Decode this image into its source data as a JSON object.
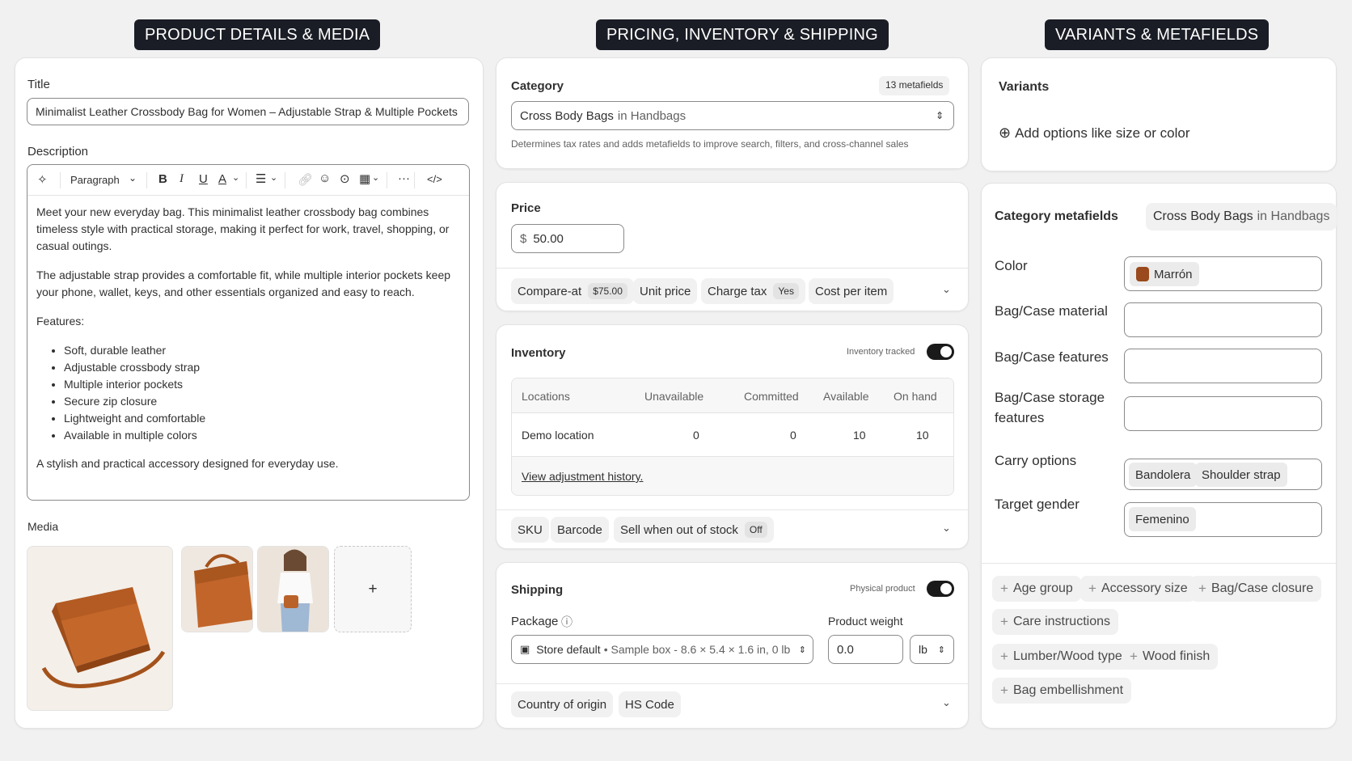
{
  "sections": {
    "details": "PRODUCT DETAILS & MEDIA",
    "pricing": "PRICING, INVENTORY & SHIPPING",
    "variants": "VARIANTS & METAFIELDS"
  },
  "details": {
    "title_label": "Title",
    "title_value": "Minimalist Leather Crossbody Bag for Women – Adjustable Strap & Multiple Pockets",
    "description_label": "Description",
    "toolbar": {
      "paragraph": "Paragraph",
      "bold": "B",
      "italic": "I",
      "underline": "U",
      "text_color": "A",
      "more": "···",
      "code": "</>"
    },
    "description": {
      "p1": "Meet your new everyday bag. This minimalist leather crossbody bag combines timeless style with practical storage, making it perfect for work, travel, shopping, or casual outings.",
      "p2": "The adjustable strap provides a comfortable fit, while multiple interior pockets keep your phone, wallet, keys, and other essentials organized and easy to reach.",
      "features_heading": "Features:",
      "features": [
        "Soft, durable leather",
        "Adjustable crossbody strap",
        "Multiple interior pockets",
        "Secure zip closure",
        "Lightweight and comfortable",
        "Available in multiple colors"
      ],
      "closing": "A stylish and practical accessory designed for everyday use."
    },
    "media_label": "Media",
    "add_media": "+"
  },
  "pricing": {
    "category_label": "Category",
    "metafields_badge": "13 metafields",
    "category_value": "Cross Body Bags",
    "category_in": "in Handbags",
    "category_help": "Determines tax rates and adds metafields to improve search, filters, and cross-channel sales",
    "price_label": "Price",
    "currency": "$",
    "price_value": "50.00",
    "compare_at_label": "Compare-at",
    "compare_at_value": "$75.00",
    "unit_price": "Unit price",
    "charge_tax_label": "Charge tax",
    "charge_tax_value": "Yes",
    "cost_per_item": "Cost per item",
    "inventory_label": "Inventory",
    "inventory_tracked": "Inventory tracked",
    "inv_headers": [
      "Locations",
      "Unavailable",
      "Committed",
      "Available",
      "On hand"
    ],
    "inv_row": [
      "Demo location",
      "0",
      "0",
      "10",
      "10"
    ],
    "view_history": "View adjustment history.",
    "sku": "SKU",
    "barcode": "Barcode",
    "sell_oos_label": "Sell when out of stock",
    "sell_oos_value": "Off",
    "shipping_label": "Shipping",
    "physical_product": "Physical product",
    "package_label": "Package",
    "package_name": "Store default",
    "package_detail": "• Sample box - 8.6 × 5.4 × 1.6 in, 0 lb",
    "weight_label": "Product weight",
    "weight_value": "0.0",
    "weight_unit": "lb",
    "country_origin": "Country of origin",
    "hs_code": "HS Code"
  },
  "variants": {
    "label": "Variants",
    "add_options": "Add options like size or color",
    "category_metafields_label": "Category metafields",
    "category_chip_main": "Cross Body Bags",
    "category_chip_in": "in Handbags",
    "fields": {
      "color_label": "Color",
      "color_value": "Marrón",
      "color_swatch": "#9a4a1c",
      "material_label": "Bag/Case material",
      "features_label": "Bag/Case features",
      "storage_label": "Bag/Case storage features",
      "carry_label": "Carry options",
      "carry_values": [
        "Bandolera",
        "Shoulder strap"
      ],
      "gender_label": "Target gender",
      "gender_value": "Femenino"
    },
    "add_fields": [
      "Age group",
      "Accessory size",
      "Bag/Case closure",
      "Care instructions",
      "Lumber/Wood type",
      "Wood finish",
      "Bag embellishment"
    ]
  }
}
